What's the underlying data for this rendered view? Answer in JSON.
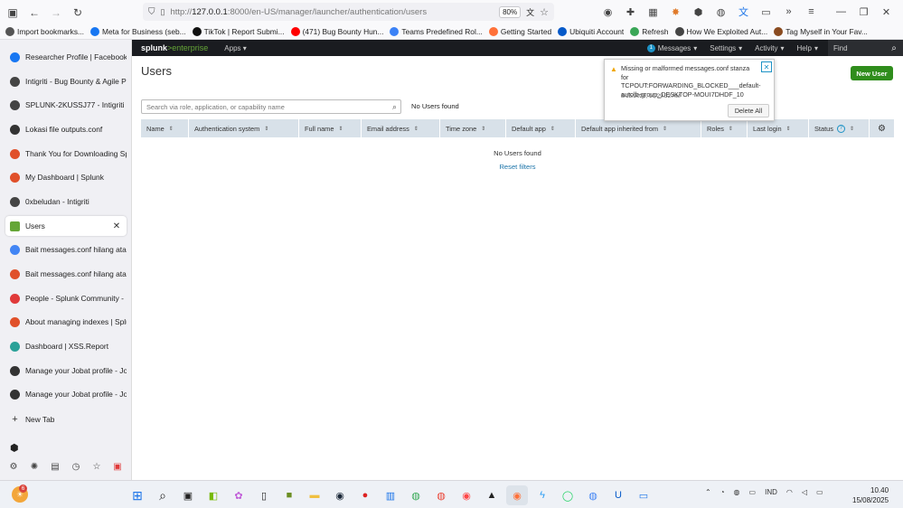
{
  "browser": {
    "url_prefix": "http://",
    "url_host": "127.0.0.1",
    "url_rest": ":8000/en-US/manager/launcher/authentication/users",
    "zoom": "80%"
  },
  "bookmarks": [
    {
      "label": "Import bookmarks...",
      "color": "#555555",
      "icon": "import-icon"
    },
    {
      "label": "Meta for Business (seb...",
      "color": "#1877f2",
      "icon": "facebook-icon"
    },
    {
      "label": "TikTok | Report Submi...",
      "color": "#111111",
      "icon": "tiktok-icon"
    },
    {
      "label": "(471) Bug Bounty Hun...",
      "color": "#ff0000",
      "icon": "youtube-icon"
    },
    {
      "label": "Teams Predefined Rol...",
      "color": "#3b82f6",
      "icon": "teams-icon"
    },
    {
      "label": "Getting Started",
      "color": "#ff7139",
      "icon": "firefox-icon"
    },
    {
      "label": "Ubiquiti Account",
      "color": "#0559c9",
      "icon": "ubiquiti-icon"
    },
    {
      "label": "Refresh",
      "color": "#3aa657",
      "icon": "refresh-bookmark-icon"
    },
    {
      "label": "How We Exploited Aut...",
      "color": "#444444",
      "icon": "medium-icon"
    },
    {
      "label": "Tag Myself in Your Fav...",
      "color": "#8a4b20",
      "icon": "bookmark-icon"
    }
  ],
  "tabs": [
    {
      "label": "Researcher Profile | Facebook",
      "color": "#1877f2",
      "icon": "facebook-icon"
    },
    {
      "label": "Intigriti - Bug Bounty & Agile P",
      "color": "#444444",
      "icon": "intigriti-icon"
    },
    {
      "label": "SPLUNK-2KUSSJ77 - Intigriti",
      "color": "#444444",
      "icon": "intigriti-icon"
    },
    {
      "label": "Lokasi file outputs.conf",
      "color": "#333333",
      "icon": "site-icon"
    },
    {
      "label": "Thank You for Downloading Sp",
      "color": "#e0502a",
      "icon": "splunk-icon"
    },
    {
      "label": "My Dashboard | Splunk",
      "color": "#e0502a",
      "icon": "splunk-icon"
    },
    {
      "label": "0xbeludan - Intigriti",
      "color": "#444444",
      "icon": "intigriti-icon"
    },
    {
      "label": "Users",
      "color": "#65a637",
      "icon": "splunk-app-icon",
      "active": true
    },
    {
      "label": "Bait messages.conf hilang atau",
      "color": "#4285f4",
      "icon": "google-icon"
    },
    {
      "label": "Bait messages.conf hilang atau",
      "color": "#e0502a",
      "icon": "splunk-icon"
    },
    {
      "label": "People - Splunk Community -",
      "color": "#e03a3a",
      "icon": "community-icon"
    },
    {
      "label": "About managing indexes | Splu",
      "color": "#e0502a",
      "icon": "splunk-icon"
    },
    {
      "label": "Dashboard | XSS.Report",
      "color": "#2aa198",
      "icon": "xss-icon"
    },
    {
      "label": "Manage your Jobat profile - Jo",
      "color": "#333333",
      "icon": "jobat-icon"
    },
    {
      "label": "Manage your Jobat profile - Jo",
      "color": "#333333",
      "icon": "jobat-icon"
    },
    {
      "label": "New Tab",
      "color": "#555555",
      "icon": "plus-icon"
    }
  ],
  "splunk": {
    "logo_a": "splunk",
    "logo_b": ">enterprise",
    "apps": "Apps",
    "messages_count": "1",
    "messages": "Messages",
    "settings": "Settings",
    "activity": "Activity",
    "help": "Help",
    "find": "Find",
    "page_title": "Users",
    "new_user": "New User",
    "search_placeholder": "Search via role, application, or capability name",
    "no_users_top": "No Users found",
    "columns": [
      "Name",
      "Authentication system",
      "Full name",
      "Email address",
      "Time zone",
      "Default app",
      "Default app inherited from",
      "Roles",
      "Last login",
      "Status"
    ],
    "no_users": "No Users found",
    "reset_filters": "Reset filters"
  },
  "popup": {
    "message": "Missing or malformed messages.conf stanza for TCPOUT:FORWARDING_BLOCKED___default-autolb-group_DESKTOP-MOUI7DHDF_10",
    "date": "8/15/2025, 10:29:32 AM",
    "delete_all": "Delete All"
  },
  "taskbar": {
    "weather_badge": "6",
    "language": "IND",
    "time": "10.40",
    "date": "15/08/2025"
  }
}
